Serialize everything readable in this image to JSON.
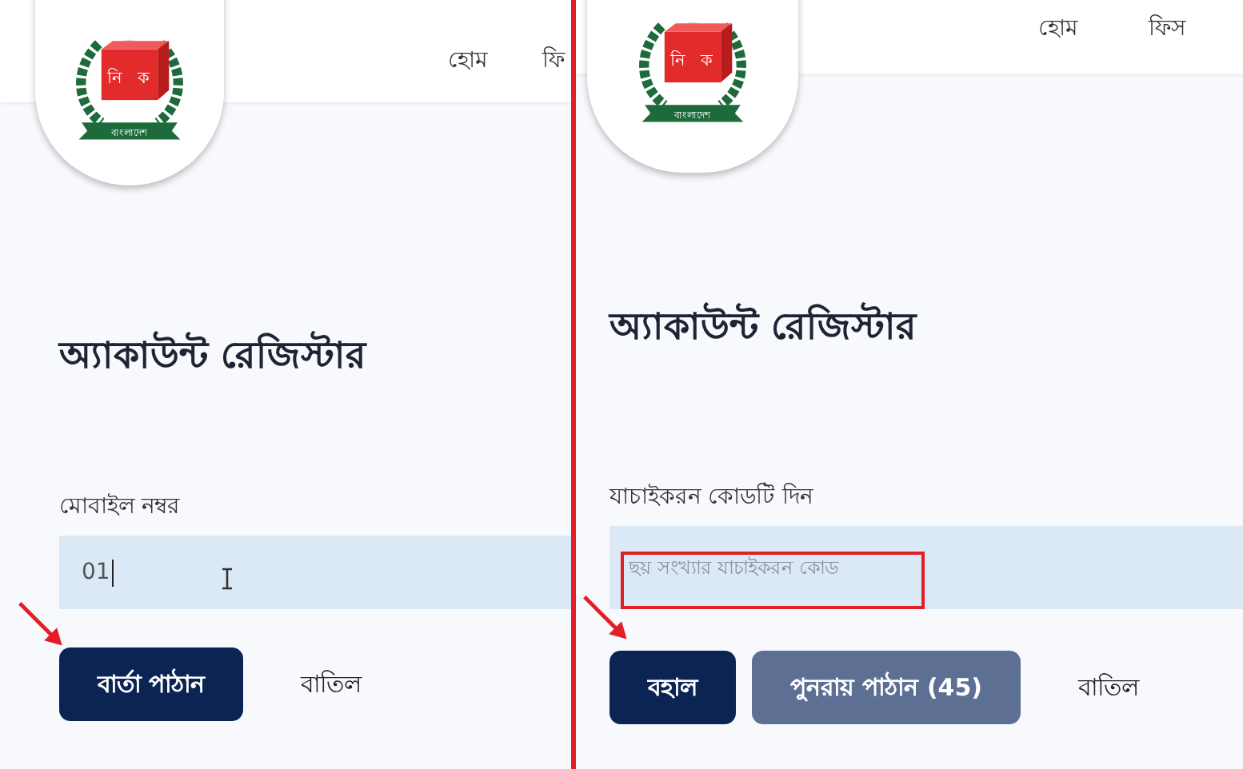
{
  "panels": [
    {
      "nav": [
        "হোম",
        "ফি"
      ],
      "logo": {
        "box_text": [
          "নি",
          "ক"
        ],
        "ribbon_text": "বাংলাদেশ"
      },
      "title": "অ্যাকাউন্ট রেজিস্টার",
      "field": {
        "label": "মোবাইল নম্বর",
        "value": "01",
        "highlighted": false
      },
      "buttons": [
        {
          "label": "বার্তা পাঠান",
          "kind": "primary"
        },
        {
          "label": "বাতিল",
          "kind": "text"
        }
      ],
      "arrow": true
    },
    {
      "nav": [
        "হোম",
        "ফিস"
      ],
      "logo": {
        "box_text": [
          "নি",
          "ক"
        ],
        "ribbon_text": "বাংলাদেশ"
      },
      "title": "অ্যাকাউন্ট রেজিস্টার",
      "field": {
        "label": "যাচাইকরন কোডটি দিন",
        "placeholder": "ছয় সংখ্যার যাচাইকরন কোড",
        "highlighted": true
      },
      "buttons": [
        {
          "label": "বহাল",
          "kind": "primary"
        },
        {
          "label": "পুনরায় পাঠান (45)",
          "kind": "secondary"
        },
        {
          "label": "বাতিল",
          "kind": "text"
        }
      ],
      "arrow": true
    }
  ]
}
